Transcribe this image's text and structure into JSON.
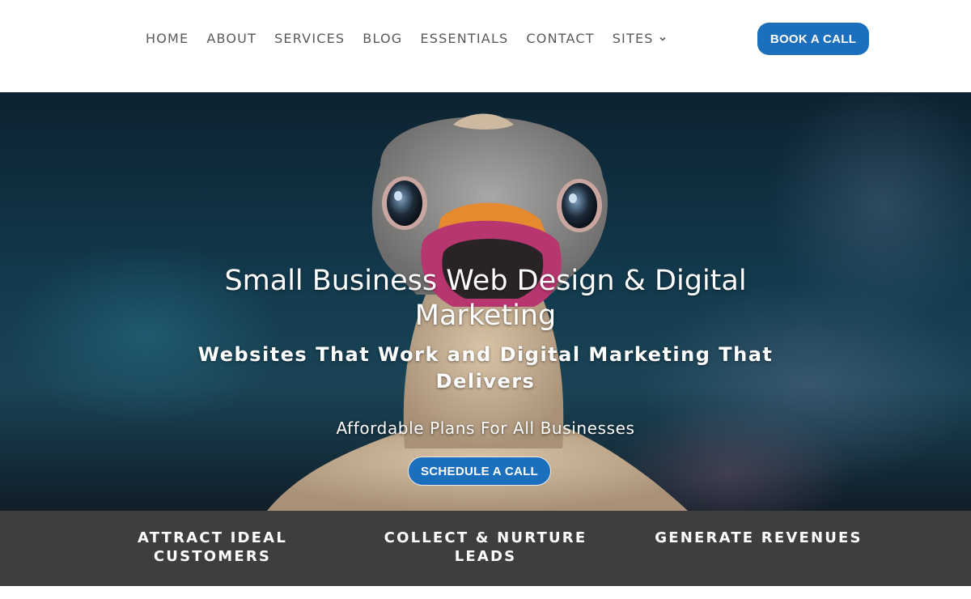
{
  "nav": {
    "items": [
      {
        "label": "HOME"
      },
      {
        "label": "ABOUT"
      },
      {
        "label": "SERVICES"
      },
      {
        "label": "BLOG"
      },
      {
        "label": "ESSENTIALS"
      },
      {
        "label": "CONTACT"
      },
      {
        "label": "SITES"
      }
    ],
    "book_cta": "BOOK A CALL"
  },
  "hero": {
    "title": "Small Business Web Design & Digital Marketing",
    "subtitle": "Websites That Work and Digital Marketing That Delivers",
    "tagline": "Affordable Plans For All Businesses",
    "cta": "SCHEDULE A CALL",
    "image": "ostrich-illustration"
  },
  "features": [
    {
      "label": "ATTRACT IDEAL CUSTOMERS"
    },
    {
      "label": "COLLECT & NURTURE LEADS"
    },
    {
      "label": "GENERATE REVENUES"
    }
  ],
  "colors": {
    "accent": "#1b6fbd",
    "band": "#3e3e3e",
    "nav_text": "#5a5a5a"
  }
}
